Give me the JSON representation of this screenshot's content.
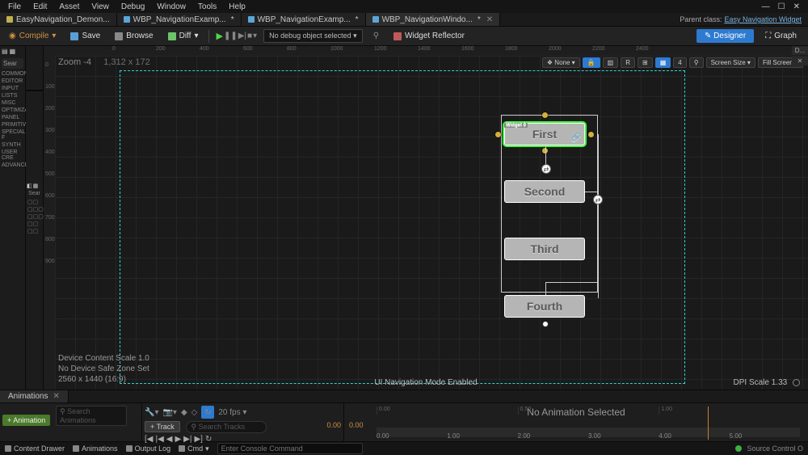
{
  "menu": {
    "items": [
      "File",
      "Edit",
      "Asset",
      "View",
      "Debug",
      "Window",
      "Tools",
      "Help"
    ]
  },
  "tabs": [
    {
      "label": "EasyNavigation_Demon...",
      "icon": "level"
    },
    {
      "label": "WBP_NavigationExamp...",
      "icon": "widget",
      "dirty": true
    },
    {
      "label": "WBP_NavigationExamp...",
      "icon": "widget",
      "dirty": true
    },
    {
      "label": "WBP_NavigationWindo...",
      "icon": "widget",
      "dirty": true,
      "active": true
    }
  ],
  "parent_class": {
    "label": "Parent class:",
    "value": "Easy Navigation Widget"
  },
  "toolbar": {
    "compile": "Compile",
    "save": "Save",
    "browse": "Browse",
    "diff": "Diff",
    "debug_selector": "No debug object selected",
    "reflector": "Widget Reflector",
    "designer": "Designer",
    "graph": "Graph"
  },
  "palette": {
    "search": "Sear",
    "cats": [
      "COMMON",
      "EDITOR",
      "INPUT",
      "LISTS",
      "MISC",
      "OPTIMIZA",
      "PANEL",
      "PRIMITIVE",
      "SPECIAL F",
      "SYNTH",
      "USER CRE",
      "ADVANCE"
    ]
  },
  "hierarchy": {
    "search": "Sear"
  },
  "viewport": {
    "zoom_label": "Zoom -4",
    "cursor_pos": "1,312 x 172",
    "none": "None",
    "r_label": "R",
    "grid_num": "4",
    "screen_size": "Screen Size",
    "fill_screen": "Fill Screen",
    "ruler_h": [
      "0",
      "200",
      "400",
      "600",
      "800",
      "1000",
      "1200",
      "1400",
      "1600",
      "1800",
      "2000",
      "2200",
      "2400"
    ],
    "ruler_v": [
      "0",
      "100",
      "200",
      "300",
      "400",
      "500",
      "600",
      "700",
      "800",
      "900"
    ],
    "widget_tag": "Widget 0",
    "buttons": [
      {
        "label": "First",
        "selected": true
      },
      {
        "label": "Second"
      },
      {
        "label": "Third"
      },
      {
        "label": "Fourth"
      }
    ],
    "footer": {
      "device_scale": "Device Content Scale 1.0",
      "safe_zone": "No Device Safe Zone Set",
      "resolution": "2560 x 1440 (16:9)",
      "nav_mode": "UI Navigation Mode Enabled",
      "dpi": "DPI Scale 1.33"
    }
  },
  "right_edge": [
    "D...",
    "✕"
  ],
  "anim": {
    "tab": "Animations",
    "add": "+ Animation",
    "search_ph": "Search Animations",
    "fps": "20 fps",
    "add_track": "+ Track",
    "track_search_ph": "Search Tracks",
    "time": "0.00",
    "no_selection": "No Animation Selected",
    "ticks_top": [
      "0.00",
      "0.50",
      "1.00"
    ],
    "ticks_bottom": [
      "0.00",
      "1.00",
      "2.00",
      "3.00",
      "4.00",
      "5.00"
    ]
  },
  "bottom": {
    "drawer": "Content Drawer",
    "anims": "Animations",
    "output": "Output Log",
    "cmd": "Cmd",
    "cmd_ph": "Enter Console Command",
    "src": "Source Control O"
  }
}
